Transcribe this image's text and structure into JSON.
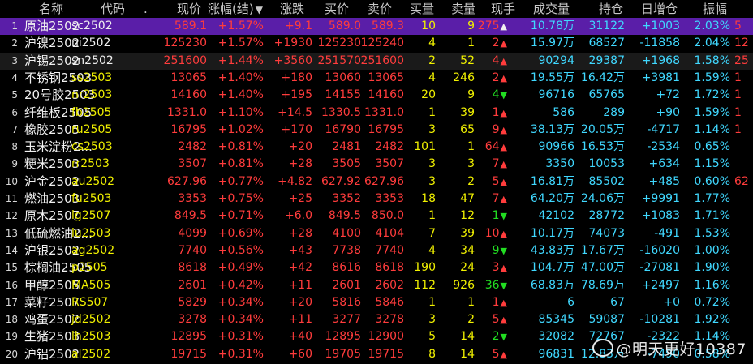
{
  "headers": [
    "名称",
    "代码",
    ".",
    "现价",
    "涨幅(结)",
    "涨跌",
    "买价",
    "卖价",
    "买量",
    "卖量",
    "现手",
    "成交量",
    "持仓",
    "日增仓",
    "振幅"
  ],
  "rows": [
    {
      "no": "1",
      "name": "原油2502",
      "code": "sc2502",
      "price": "589.1",
      "pct": "+1.57%",
      "chg": "+9.1",
      "bid": "589.0",
      "ask": "589.3",
      "bidv": "10",
      "askv": "9",
      "last": "275",
      "dir": "up",
      "vol": "10.78万",
      "oi": "31122",
      "oichg": "+1003",
      "amp": "2.03%",
      "extra": "5"
    },
    {
      "no": "2",
      "name": "沪镍2502",
      "code": "ni2502",
      "price": "125230",
      "pct": "+1.57%",
      "chg": "+1930",
      "bid": "125230",
      "ask": "125240",
      "bidv": "4",
      "askv": "1",
      "last": "2",
      "dir": "up",
      "vol": "15.97万",
      "oi": "68527",
      "oichg": "-11858",
      "amp": "2.04%",
      "extra": "12"
    },
    {
      "no": "3",
      "name": "沪锡2502",
      "code": "sn2502",
      "price": "251600",
      "pct": "+1.44%",
      "chg": "+3560",
      "bid": "251570",
      "ask": "251600",
      "bidv": "2",
      "askv": "52",
      "last": "4",
      "dir": "up",
      "vol": "90294",
      "oi": "29387",
      "oichg": "+1968",
      "amp": "1.58%",
      "extra": "25"
    },
    {
      "no": "4",
      "name": "不锈钢2503",
      "code": "ss2503",
      "price": "13065",
      "pct": "+1.40%",
      "chg": "+180",
      "bid": "13060",
      "ask": "13065",
      "bidv": "4",
      "askv": "246",
      "last": "2",
      "dir": "up",
      "vol": "19.55万",
      "oi": "16.42万",
      "oichg": "+3981",
      "amp": "1.59%",
      "extra": "1"
    },
    {
      "no": "5",
      "name": "20号胶2503",
      "code": "nr2503",
      "price": "14160",
      "pct": "+1.40%",
      "chg": "+195",
      "bid": "14155",
      "ask": "14160",
      "bidv": "20",
      "askv": "9",
      "last": "4",
      "dir": "down",
      "vol": "96716",
      "oi": "65765",
      "oichg": "+72",
      "amp": "1.72%",
      "extra": "1"
    },
    {
      "no": "6",
      "name": "纤维板2505",
      "code": "fb2505",
      "price": "1331.0",
      "pct": "+1.10%",
      "chg": "+14.5",
      "bid": "1330.5",
      "ask": "1331.0",
      "bidv": "1",
      "askv": "39",
      "last": "1",
      "dir": "up",
      "vol": "586",
      "oi": "289",
      "oichg": "+90",
      "amp": "1.59%",
      "extra": "1"
    },
    {
      "no": "7",
      "name": "橡胶2505",
      "code": "ru2505",
      "price": "16795",
      "pct": "+1.02%",
      "chg": "+170",
      "bid": "16790",
      "ask": "16795",
      "bidv": "3",
      "askv": "65",
      "last": "9",
      "dir": "up",
      "vol": "38.13万",
      "oi": "20.05万",
      "oichg": "-4717",
      "amp": "1.14%",
      "extra": "1"
    },
    {
      "no": "8",
      "name": "玉米淀粉2...",
      "code": "cs2503",
      "price": "2482",
      "pct": "+0.81%",
      "chg": "+20",
      "bid": "2481",
      "ask": "2482",
      "bidv": "101",
      "askv": "1",
      "last": "64",
      "dir": "up",
      "vol": "90966",
      "oi": "16.53万",
      "oichg": "-2534",
      "amp": "0.65%",
      "extra": ""
    },
    {
      "no": "9",
      "name": "粳米2503",
      "code": "rr2503",
      "price": "3507",
      "pct": "+0.81%",
      "chg": "+28",
      "bid": "3505",
      "ask": "3507",
      "bidv": "3",
      "askv": "3",
      "last": "7",
      "dir": "up",
      "vol": "3350",
      "oi": "10053",
      "oichg": "+634",
      "amp": "1.15%",
      "extra": ""
    },
    {
      "no": "10",
      "name": "沪金2502",
      "code": "au2502",
      "price": "627.96",
      "pct": "+0.77%",
      "chg": "+4.82",
      "bid": "627.92",
      "ask": "627.96",
      "bidv": "3",
      "askv": "2",
      "last": "5",
      "dir": "up",
      "vol": "16.81万",
      "oi": "85502",
      "oichg": "+485",
      "amp": "0.60%",
      "extra": "62"
    },
    {
      "no": "11",
      "name": "燃油2503",
      "code": "fu2503",
      "price": "3353",
      "pct": "+0.75%",
      "chg": "+25",
      "bid": "3352",
      "ask": "3353",
      "bidv": "18",
      "askv": "47",
      "last": "7",
      "dir": "up",
      "vol": "64.20万",
      "oi": "24.06万",
      "oichg": "+9991",
      "amp": "1.77%",
      "extra": ""
    },
    {
      "no": "12",
      "name": "原木2507",
      "code": "lg2507",
      "price": "849.5",
      "pct": "+0.71%",
      "chg": "+6.0",
      "bid": "849.5",
      "ask": "850.0",
      "bidv": "1",
      "askv": "12",
      "last": "1",
      "dir": "down",
      "vol": "42102",
      "oi": "28772",
      "oichg": "+1083",
      "amp": "1.71%",
      "extra": ""
    },
    {
      "no": "13",
      "name": "低硫燃油2...",
      "code": "lu2503",
      "price": "4099",
      "pct": "+0.69%",
      "chg": "+28",
      "bid": "4100",
      "ask": "4104",
      "bidv": "7",
      "askv": "39",
      "last": "10",
      "dir": "up",
      "vol": "10.17万",
      "oi": "74073",
      "oichg": "-491",
      "amp": "1.53%",
      "extra": ""
    },
    {
      "no": "14",
      "name": "沪银2502",
      "code": "ag2502",
      "price": "7740",
      "pct": "+0.56%",
      "chg": "+43",
      "bid": "7738",
      "ask": "7740",
      "bidv": "4",
      "askv": "34",
      "last": "9",
      "dir": "down",
      "vol": "43.83万",
      "oi": "17.67万",
      "oichg": "-16020",
      "amp": "1.00%",
      "extra": ""
    },
    {
      "no": "15",
      "name": "棕榈油2505",
      "code": "p2505",
      "price": "8618",
      "pct": "+0.49%",
      "chg": "+42",
      "bid": "8616",
      "ask": "8618",
      "bidv": "190",
      "askv": "24",
      "last": "3",
      "dir": "up",
      "vol": "104.7万",
      "oi": "47.00万",
      "oichg": "-27081",
      "amp": "1.90%",
      "extra": ""
    },
    {
      "no": "16",
      "name": "甲醇2505",
      "code": "MA505",
      "price": "2601",
      "pct": "+0.42%",
      "chg": "+11",
      "bid": "2601",
      "ask": "2602",
      "bidv": "112",
      "askv": "926",
      "last": "36",
      "dir": "down",
      "vol": "68.83万",
      "oi": "78.69万",
      "oichg": "+2497",
      "amp": "1.16%",
      "extra": ""
    },
    {
      "no": "17",
      "name": "菜籽2507",
      "code": "RS507",
      "price": "5829",
      "pct": "+0.34%",
      "chg": "+20",
      "bid": "5816",
      "ask": "5846",
      "bidv": "1",
      "askv": "1",
      "last": "1",
      "dir": "up",
      "vol": "6",
      "oi": "67",
      "oichg": "+0",
      "amp": "0.72%",
      "extra": ""
    },
    {
      "no": "18",
      "name": "鸡蛋2502",
      "code": "jd2502",
      "price": "3278",
      "pct": "+0.34%",
      "chg": "+11",
      "bid": "3277",
      "ask": "3278",
      "bidv": "3",
      "askv": "2",
      "last": "5",
      "dir": "up",
      "vol": "85345",
      "oi": "59087",
      "oichg": "-10281",
      "amp": "1.92%",
      "extra": ""
    },
    {
      "no": "19",
      "name": "生猪2503",
      "code": "lh2503",
      "price": "12895",
      "pct": "+0.31%",
      "chg": "+40",
      "bid": "12895",
      "ask": "12900",
      "bidv": "5",
      "askv": "14",
      "last": "2",
      "dir": "down",
      "vol": "32082",
      "oi": "72767",
      "oichg": "-2322",
      "amp": "1.14%",
      "extra": ""
    },
    {
      "no": "20",
      "name": "沪铝2502",
      "code": "al2502",
      "price": "19715",
      "pct": "+0.31%",
      "chg": "+60",
      "bid": "19705",
      "ask": "19715",
      "bidv": "8",
      "askv": "14",
      "last": "5",
      "dir": "up",
      "vol": "96831",
      "oi": "12.83万",
      "oichg": "-7490",
      "amp": "0.58%",
      "extra": ""
    }
  ],
  "sort_icon": "sort-desc-arrow-icon",
  "watermark": "@明天更好10387",
  "colors": {
    "up": "#ff3c3c",
    "down": "#22dd22",
    "name": "#f0f0f0",
    "volume": "#40d8ff",
    "qty": "#f0f000",
    "selected_row": "#5a1ea8"
  }
}
